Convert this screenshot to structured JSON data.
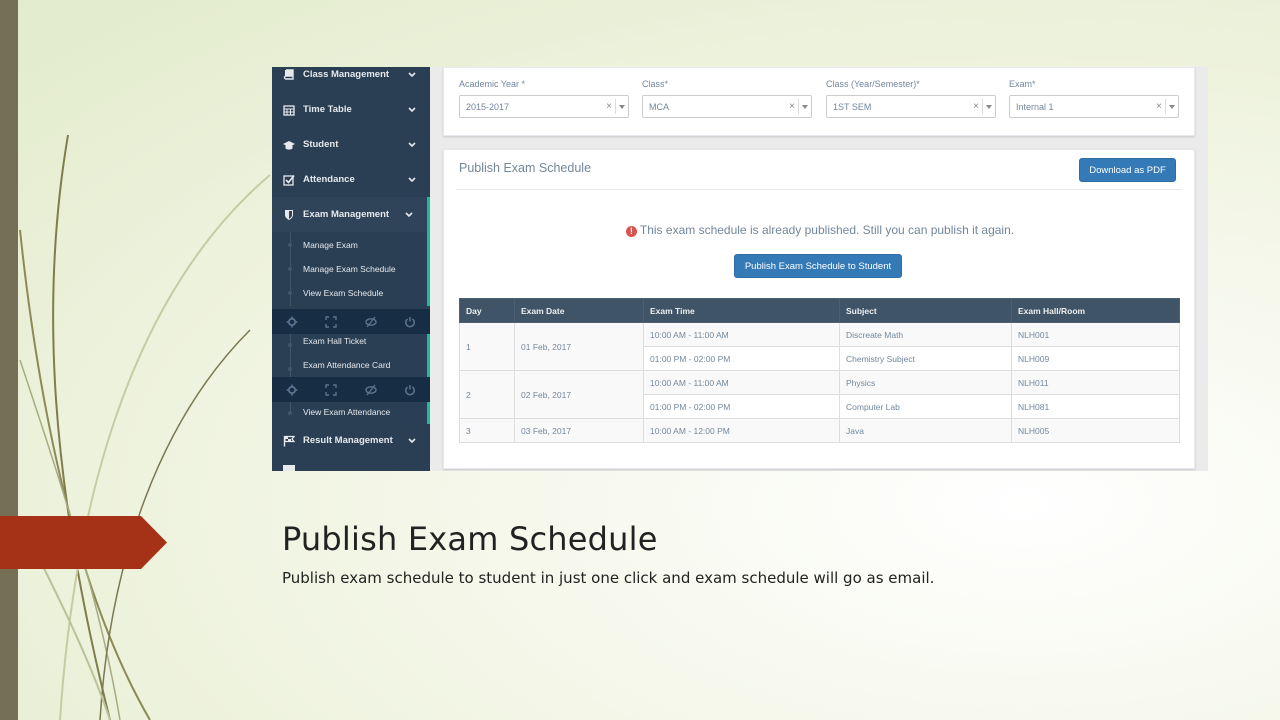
{
  "sidebar": {
    "items": [
      {
        "label": "Class Management",
        "icon": "book-icon"
      },
      {
        "label": "Time Table",
        "icon": "calendar-icon"
      },
      {
        "label": "Student",
        "icon": "graduation-cap-icon"
      },
      {
        "label": "Attendance",
        "icon": "checkbox-icon"
      },
      {
        "label": "Exam Management",
        "icon": "shield-icon"
      }
    ],
    "exam_submenu": [
      "Manage Exam",
      "Manage Exam Schedule",
      "View Exam Schedule",
      "Exam Hall Ticket",
      "Exam Attendance Card",
      "View Exam Attendance"
    ],
    "result_item": {
      "label": "Result Management",
      "icon": "flag-icon"
    },
    "footer_icons": [
      "gear-icon",
      "fullscreen-icon",
      "eye-slash-icon",
      "power-icon"
    ]
  },
  "filters": [
    {
      "label": "Academic Year *",
      "value": "2015-2017"
    },
    {
      "label": "Class*",
      "value": "MCA"
    },
    {
      "label": "Class (Year/Semester)*",
      "value": "1ST SEM"
    },
    {
      "label": "Exam*",
      "value": "Internal 1"
    }
  ],
  "publish": {
    "title": "Publish Exam Schedule",
    "download_button": "Download as PDF",
    "notice": "This exam schedule is already published. Still you can publish it again.",
    "publish_button": "Publish Exam Schedule to Student",
    "headers": [
      "Day",
      "Exam Date",
      "Exam Time",
      "Subject",
      "Exam Hall/Room"
    ],
    "days": [
      {
        "day": "1",
        "date": "01 Feb, 2017",
        "exams": [
          {
            "time": "10:00 AM - 11:00 AM",
            "subject": "Discreate Math",
            "room": "NLH001"
          },
          {
            "time": "01:00 PM - 02:00 PM",
            "subject": "Chemistry Subject",
            "room": "NLH009"
          }
        ]
      },
      {
        "day": "2",
        "date": "02 Feb, 2017",
        "exams": [
          {
            "time": "10:00 AM - 11:00 AM",
            "subject": "Physics",
            "room": "NLH011"
          },
          {
            "time": "01:00 PM - 02:00 PM",
            "subject": "Computer Lab",
            "room": "NLH081"
          }
        ]
      },
      {
        "day": "3",
        "date": "03 Feb, 2017",
        "exams": [
          {
            "time": "10:00 AM - 12:00 PM",
            "subject": "Java",
            "room": "NLH005"
          }
        ]
      }
    ]
  },
  "caption": {
    "title": "Publish Exam Schedule",
    "body": "Publish exam schedule to student in just one click and exam schedule will go as email."
  },
  "colors": {
    "sidebar": "#2a3f54",
    "accent": "#1abb9c",
    "button": "#337ab7",
    "arrow": "#a53217"
  }
}
